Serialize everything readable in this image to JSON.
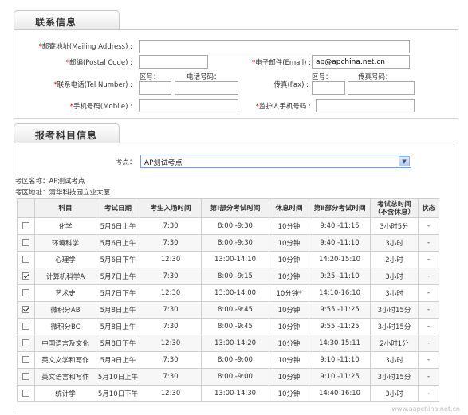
{
  "contact": {
    "section_title": "联系信息",
    "mailing_address_label": "邮寄地址(Mailing Address) :",
    "mailing_address_value": "",
    "postal_code_label": "邮编(Postal Code) :",
    "postal_code_value": "",
    "email_label": "电子邮件(Email) :",
    "email_value": "ap@apchina.net.cn",
    "tel_label": "联系电话(Tel Number) :",
    "tel_area_label": "区号：",
    "tel_number_label": "电话号码：",
    "fax_label": "传真(Fax) :",
    "fax_area_label": "区号：",
    "fax_number_label": "传真号码：",
    "mobile_label": "手机号码(Mobile) :",
    "guardian_mobile_label": "监护人手机号码 :"
  },
  "exam": {
    "section_title": "报考科目信息",
    "exam_site_label": "考点：",
    "exam_site_selected": "AP测试考点",
    "exam_area_name": "考区名称：AP测试考点",
    "exam_area_address": "考区地址：清华科技园立业大厦",
    "headers": [
      "",
      "科目",
      "考试日期",
      "考生入场时间",
      "第Ⅰ部分考试时间",
      "休息时间",
      "第Ⅱ部分考试时间",
      "考试总时间（不含休息）",
      "状态"
    ],
    "rows": [
      {
        "checked": false,
        "subject": "化学",
        "date": "5月6日上午",
        "entry": "7:30",
        "part1": "8:00 -9:30",
        "break": "10分钟",
        "part2": "9:40 -11:15",
        "total": "3小时5分",
        "status": "-"
      },
      {
        "checked": false,
        "subject": "环境科学",
        "date": "5月6日上午",
        "entry": "7:30",
        "part1": "8:00 -9:30",
        "break": "10分钟",
        "part2": "9:40 -11:10",
        "total": "3小时",
        "status": "-"
      },
      {
        "checked": false,
        "subject": "心理学",
        "date": "5月6日下午",
        "entry": "12:30",
        "part1": "13:00-14:10",
        "break": "10分钟",
        "part2": "14:20-15:10",
        "total": "2小时",
        "status": "-"
      },
      {
        "checked": true,
        "subject": "计算机科学A",
        "date": "5月7日上午",
        "entry": "7:30",
        "part1": "8:00 -9:15",
        "break": "10分钟",
        "part2": "9:25 -11:10",
        "total": "3小时",
        "status": "-"
      },
      {
        "checked": false,
        "subject": "艺术史",
        "date": "5月7日下午",
        "entry": "12:30",
        "part1": "13:00-14:00",
        "break": "10分钟*",
        "part2": "14:10-16:10",
        "total": "3小时",
        "status": "-"
      },
      {
        "checked": true,
        "subject": "微积分AB",
        "date": "5月8日上午",
        "entry": "7:30",
        "part1": "8:00 -9:45",
        "break": "10分钟",
        "part2": "9:55 -11:25",
        "total": "3小时15分",
        "status": "-"
      },
      {
        "checked": false,
        "subject": "微积分BC",
        "date": "5月8日上午",
        "entry": "7:30",
        "part1": "8:00 -9:45",
        "break": "10分钟",
        "part2": "9:55 -11:25",
        "total": "3小时15分",
        "status": "-"
      },
      {
        "checked": false,
        "subject": "中国语言及文化",
        "date": "5月8日下午",
        "entry": "12:30",
        "part1": "13:00-14:20",
        "break": "10分钟",
        "part2": "14:30-15:11",
        "total": "2小时1分",
        "status": "-"
      },
      {
        "checked": false,
        "subject": "英文文学和写作",
        "date": "5月9日上午",
        "entry": "7:30",
        "part1": "8:00 -9:00",
        "break": "10分钟",
        "part2": "9:10 -11:10",
        "total": "3小时",
        "status": "-"
      },
      {
        "checked": false,
        "subject": "英文语言和写作",
        "date": "5月10日上午",
        "entry": "7:30",
        "part1": "8:00 -9:00",
        "break": "10分钟",
        "part2": "9:10 -11:25",
        "total": "3小时15分",
        "status": "-"
      },
      {
        "checked": false,
        "subject": "统计学",
        "date": "5月10日下午",
        "entry": "12:30",
        "part1": "13:00-14:30",
        "break": "10分钟",
        "part2": "14:40-16:10",
        "total": "3小时",
        "status": "-"
      }
    ]
  }
}
